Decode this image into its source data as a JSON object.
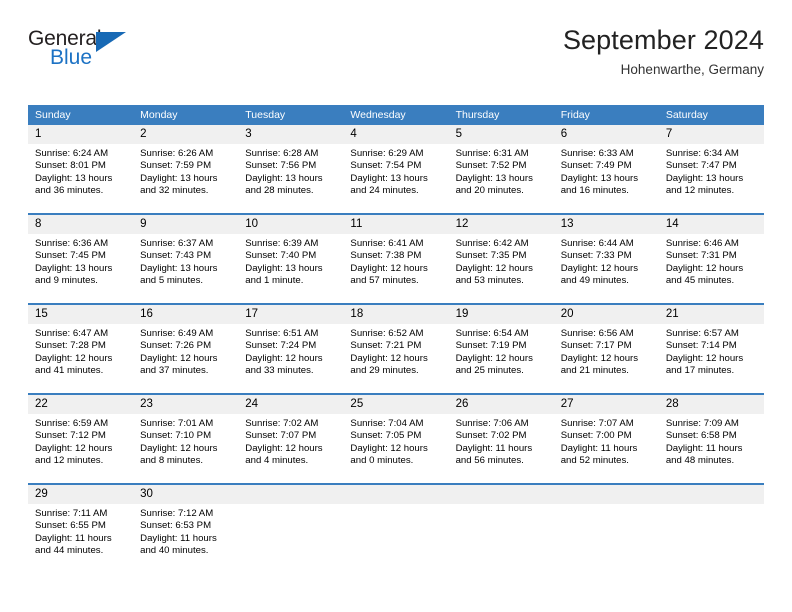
{
  "brand": {
    "name_primary": "General",
    "name_secondary": "Blue",
    "triangle_color": "#1769b5",
    "blue_text_color": "#1c72c4"
  },
  "header": {
    "title": "September 2024",
    "subtitle": "Hohenwarthe, Germany"
  },
  "theme": {
    "header_bar_color": "#3a7ebf",
    "daynum_band_color": "#f0f0f0",
    "cell_background": "#ffffff",
    "text_color": "#000000"
  },
  "weekdays": [
    "Sunday",
    "Monday",
    "Tuesday",
    "Wednesday",
    "Thursday",
    "Friday",
    "Saturday"
  ],
  "weeks": [
    {
      "days": [
        {
          "num": "1",
          "sunrise": "Sunrise: 6:24 AM",
          "sunset": "Sunset: 8:01 PM",
          "daylight1": "Daylight: 13 hours",
          "daylight2": "and 36 minutes."
        },
        {
          "num": "2",
          "sunrise": "Sunrise: 6:26 AM",
          "sunset": "Sunset: 7:59 PM",
          "daylight1": "Daylight: 13 hours",
          "daylight2": "and 32 minutes."
        },
        {
          "num": "3",
          "sunrise": "Sunrise: 6:28 AM",
          "sunset": "Sunset: 7:56 PM",
          "daylight1": "Daylight: 13 hours",
          "daylight2": "and 28 minutes."
        },
        {
          "num": "4",
          "sunrise": "Sunrise: 6:29 AM",
          "sunset": "Sunset: 7:54 PM",
          "daylight1": "Daylight: 13 hours",
          "daylight2": "and 24 minutes."
        },
        {
          "num": "5",
          "sunrise": "Sunrise: 6:31 AM",
          "sunset": "Sunset: 7:52 PM",
          "daylight1": "Daylight: 13 hours",
          "daylight2": "and 20 minutes."
        },
        {
          "num": "6",
          "sunrise": "Sunrise: 6:33 AM",
          "sunset": "Sunset: 7:49 PM",
          "daylight1": "Daylight: 13 hours",
          "daylight2": "and 16 minutes."
        },
        {
          "num": "7",
          "sunrise": "Sunrise: 6:34 AM",
          "sunset": "Sunset: 7:47 PM",
          "daylight1": "Daylight: 13 hours",
          "daylight2": "and 12 minutes."
        }
      ]
    },
    {
      "days": [
        {
          "num": "8",
          "sunrise": "Sunrise: 6:36 AM",
          "sunset": "Sunset: 7:45 PM",
          "daylight1": "Daylight: 13 hours",
          "daylight2": "and 9 minutes."
        },
        {
          "num": "9",
          "sunrise": "Sunrise: 6:37 AM",
          "sunset": "Sunset: 7:43 PM",
          "daylight1": "Daylight: 13 hours",
          "daylight2": "and 5 minutes."
        },
        {
          "num": "10",
          "sunrise": "Sunrise: 6:39 AM",
          "sunset": "Sunset: 7:40 PM",
          "daylight1": "Daylight: 13 hours",
          "daylight2": "and 1 minute."
        },
        {
          "num": "11",
          "sunrise": "Sunrise: 6:41 AM",
          "sunset": "Sunset: 7:38 PM",
          "daylight1": "Daylight: 12 hours",
          "daylight2": "and 57 minutes."
        },
        {
          "num": "12",
          "sunrise": "Sunrise: 6:42 AM",
          "sunset": "Sunset: 7:35 PM",
          "daylight1": "Daylight: 12 hours",
          "daylight2": "and 53 minutes."
        },
        {
          "num": "13",
          "sunrise": "Sunrise: 6:44 AM",
          "sunset": "Sunset: 7:33 PM",
          "daylight1": "Daylight: 12 hours",
          "daylight2": "and 49 minutes."
        },
        {
          "num": "14",
          "sunrise": "Sunrise: 6:46 AM",
          "sunset": "Sunset: 7:31 PM",
          "daylight1": "Daylight: 12 hours",
          "daylight2": "and 45 minutes."
        }
      ]
    },
    {
      "days": [
        {
          "num": "15",
          "sunrise": "Sunrise: 6:47 AM",
          "sunset": "Sunset: 7:28 PM",
          "daylight1": "Daylight: 12 hours",
          "daylight2": "and 41 minutes."
        },
        {
          "num": "16",
          "sunrise": "Sunrise: 6:49 AM",
          "sunset": "Sunset: 7:26 PM",
          "daylight1": "Daylight: 12 hours",
          "daylight2": "and 37 minutes."
        },
        {
          "num": "17",
          "sunrise": "Sunrise: 6:51 AM",
          "sunset": "Sunset: 7:24 PM",
          "daylight1": "Daylight: 12 hours",
          "daylight2": "and 33 minutes."
        },
        {
          "num": "18",
          "sunrise": "Sunrise: 6:52 AM",
          "sunset": "Sunset: 7:21 PM",
          "daylight1": "Daylight: 12 hours",
          "daylight2": "and 29 minutes."
        },
        {
          "num": "19",
          "sunrise": "Sunrise: 6:54 AM",
          "sunset": "Sunset: 7:19 PM",
          "daylight1": "Daylight: 12 hours",
          "daylight2": "and 25 minutes."
        },
        {
          "num": "20",
          "sunrise": "Sunrise: 6:56 AM",
          "sunset": "Sunset: 7:17 PM",
          "daylight1": "Daylight: 12 hours",
          "daylight2": "and 21 minutes."
        },
        {
          "num": "21",
          "sunrise": "Sunrise: 6:57 AM",
          "sunset": "Sunset: 7:14 PM",
          "daylight1": "Daylight: 12 hours",
          "daylight2": "and 17 minutes."
        }
      ]
    },
    {
      "days": [
        {
          "num": "22",
          "sunrise": "Sunrise: 6:59 AM",
          "sunset": "Sunset: 7:12 PM",
          "daylight1": "Daylight: 12 hours",
          "daylight2": "and 12 minutes."
        },
        {
          "num": "23",
          "sunrise": "Sunrise: 7:01 AM",
          "sunset": "Sunset: 7:10 PM",
          "daylight1": "Daylight: 12 hours",
          "daylight2": "and 8 minutes."
        },
        {
          "num": "24",
          "sunrise": "Sunrise: 7:02 AM",
          "sunset": "Sunset: 7:07 PM",
          "daylight1": "Daylight: 12 hours",
          "daylight2": "and 4 minutes."
        },
        {
          "num": "25",
          "sunrise": "Sunrise: 7:04 AM",
          "sunset": "Sunset: 7:05 PM",
          "daylight1": "Daylight: 12 hours",
          "daylight2": "and 0 minutes."
        },
        {
          "num": "26",
          "sunrise": "Sunrise: 7:06 AM",
          "sunset": "Sunset: 7:02 PM",
          "daylight1": "Daylight: 11 hours",
          "daylight2": "and 56 minutes."
        },
        {
          "num": "27",
          "sunrise": "Sunrise: 7:07 AM",
          "sunset": "Sunset: 7:00 PM",
          "daylight1": "Daylight: 11 hours",
          "daylight2": "and 52 minutes."
        },
        {
          "num": "28",
          "sunrise": "Sunrise: 7:09 AM",
          "sunset": "Sunset: 6:58 PM",
          "daylight1": "Daylight: 11 hours",
          "daylight2": "and 48 minutes."
        }
      ]
    },
    {
      "days": [
        {
          "num": "29",
          "sunrise": "Sunrise: 7:11 AM",
          "sunset": "Sunset: 6:55 PM",
          "daylight1": "Daylight: 11 hours",
          "daylight2": "and 44 minutes."
        },
        {
          "num": "30",
          "sunrise": "Sunrise: 7:12 AM",
          "sunset": "Sunset: 6:53 PM",
          "daylight1": "Daylight: 11 hours",
          "daylight2": "and 40 minutes."
        },
        {
          "num": "",
          "sunrise": "",
          "sunset": "",
          "daylight1": "",
          "daylight2": ""
        },
        {
          "num": "",
          "sunrise": "",
          "sunset": "",
          "daylight1": "",
          "daylight2": ""
        },
        {
          "num": "",
          "sunrise": "",
          "sunset": "",
          "daylight1": "",
          "daylight2": ""
        },
        {
          "num": "",
          "sunrise": "",
          "sunset": "",
          "daylight1": "",
          "daylight2": ""
        },
        {
          "num": "",
          "sunrise": "",
          "sunset": "",
          "daylight1": "",
          "daylight2": ""
        }
      ]
    }
  ]
}
